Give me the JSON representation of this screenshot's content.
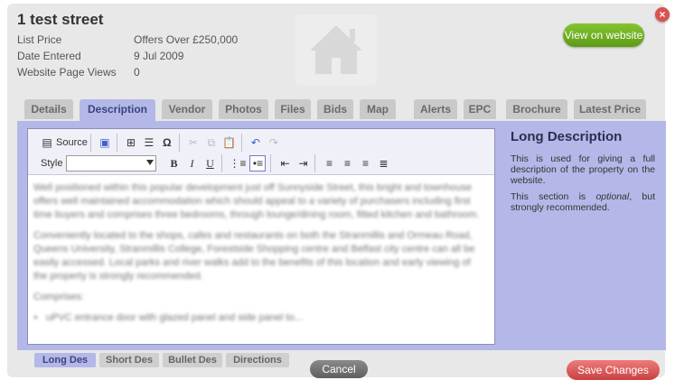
{
  "property": {
    "title": "1 test street",
    "fields": [
      {
        "label": "List Price",
        "value": "Offers Over £250,000"
      },
      {
        "label": "Date Entered",
        "value": "9 Jul 2009"
      },
      {
        "label": "Website Page Views",
        "value": "0"
      }
    ],
    "view_button": "View on website"
  },
  "tabs": [
    "Details",
    "Description",
    "Vendor",
    "Photos",
    "Files",
    "Bids",
    "Map",
    "Alerts",
    "EPC",
    "Brochure",
    "Latest Price"
  ],
  "active_tab": "Description",
  "toolbar": {
    "source_label": "Source",
    "style_label": "Style",
    "style_value": ""
  },
  "editor_text": {
    "p1": "Well positioned within this popular development just off Sunnyside Street, this bright and townhouse offers well maintained accommodation which should appeal to a variety of purchasers including first time buyers and comprises three bedrooms, through lounge/dining room, fitted kitchen and bathroom.",
    "p2": "Conveniently located to the shops, cafes and restaurants on both the Stranmillis and Ormeau Road, Queens University, Stranmillis College, Forestside Shopping centre and Belfast city centre can all be easily accessed. Local parks and river walks add to the benefits of this location and early viewing of the property is strongly recommended.",
    "p3": "Comprises:",
    "li1": "uPVC entrance door with glazed panel and side panel to..."
  },
  "help": {
    "heading": "Long Description",
    "p1": "This is used for giving a full description of the property on the website.",
    "p2_pre": "This section is ",
    "p2_em": "optional",
    "p2_post": ", but strongly recommended."
  },
  "subtabs": [
    "Long Des",
    "Short Des",
    "Bullet Des",
    "Directions"
  ],
  "active_subtab": "Long Des",
  "buttons": {
    "cancel": "Cancel",
    "save": "Save Changes"
  },
  "colors": {
    "view_button": "#6aa921",
    "save_button": "#e05a5a",
    "tab_active": "#b3b8e8",
    "close": "#d9534f"
  }
}
